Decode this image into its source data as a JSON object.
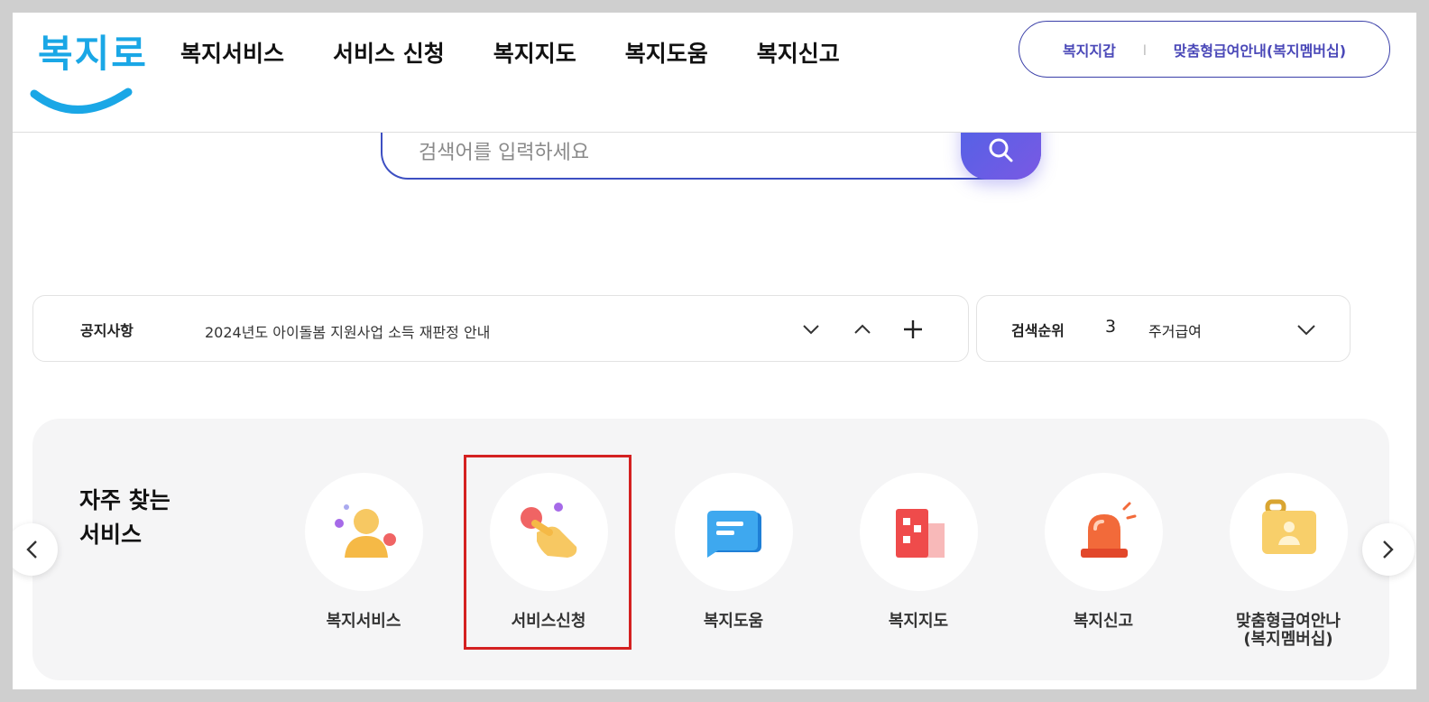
{
  "header": {
    "logo_text": "복지로",
    "nav": [
      "복지서비스",
      "서비스 신청",
      "복지지도",
      "복지도움",
      "복지신고"
    ],
    "util_links": [
      "복지지갑",
      "맞춤형급여안내(복지멤버십)"
    ],
    "util_separator": "ㅣ"
  },
  "search": {
    "placeholder": "검색어를 입력하세요"
  },
  "notice": {
    "label": "공지사항",
    "text": "2024년도 아이돌봄 지원사업 소득 재판정 안내"
  },
  "ranking": {
    "label": "검색순위",
    "number": "3",
    "text": "주거급여"
  },
  "frequent": {
    "title_line1": "자주 찾는",
    "title_line2": "서비스",
    "items": [
      {
        "label": "복지서비스",
        "icon": "person-icon"
      },
      {
        "label": "서비스신청",
        "icon": "hand-touch-icon"
      },
      {
        "label": "복지도움",
        "icon": "chat-document-icon"
      },
      {
        "label": "복지지도",
        "icon": "map-building-icon"
      },
      {
        "label": "복지신고",
        "icon": "siren-icon"
      },
      {
        "label_line1": "맞춤형급여안나",
        "label_line2": "(복지멤버십)",
        "icon": "id-card-icon"
      }
    ]
  },
  "colors": {
    "accent": "#3d4fc2",
    "logo": "#1aa7e6",
    "highlight": "#d42121"
  }
}
